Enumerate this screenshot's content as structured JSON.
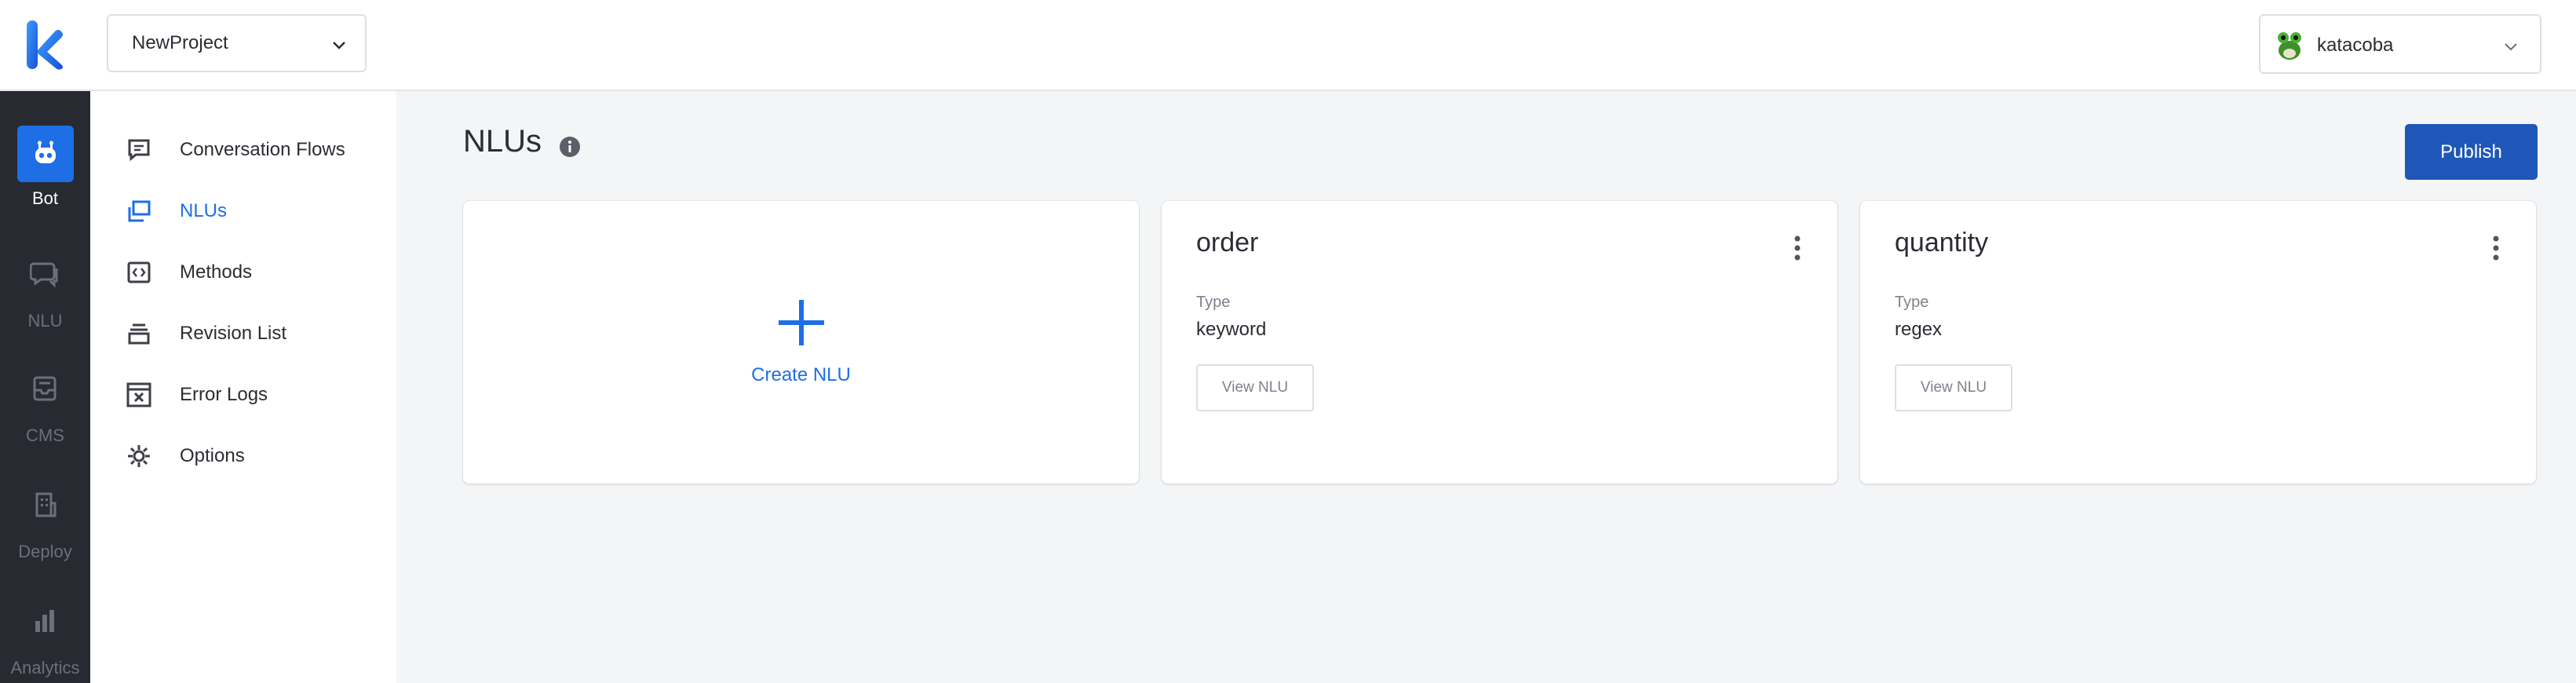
{
  "colors": {
    "accent": "#1e6ee6",
    "publish": "#1f57b8",
    "rail_bg": "#272a31"
  },
  "header": {
    "logo_icon": "katalon-k-logo",
    "project_select": {
      "value": "NewProject",
      "icon": "chevron-down-icon"
    },
    "user_menu": {
      "name": "katacoba",
      "avatar_icon": "frog-avatar",
      "icon": "chevron-down-icon"
    }
  },
  "rail": {
    "items": [
      {
        "label": "Bot",
        "icon": "robot-icon",
        "active": true
      },
      {
        "label": "NLU",
        "icon": "chat-bubbles-icon"
      },
      {
        "label": "CMS",
        "icon": "inbox-icon"
      },
      {
        "label": "Deploy",
        "icon": "building-icon"
      },
      {
        "label": "Analytics",
        "icon": "bar-chart-icon"
      }
    ]
  },
  "sidebar": {
    "items": [
      {
        "label": "Conversation Flows",
        "icon": "message-icon"
      },
      {
        "label": "NLUs",
        "icon": "stacked-windows-icon",
        "active": true
      },
      {
        "label": "Methods",
        "icon": "code-icon"
      },
      {
        "label": "Revision List",
        "icon": "layers-icon"
      },
      {
        "label": "Error Logs",
        "icon": "error-window-icon"
      },
      {
        "label": "Options",
        "icon": "gear-icon"
      }
    ]
  },
  "main": {
    "title": "NLUs",
    "info_icon": "info-icon",
    "publish_label": "Publish",
    "create_label": "Create NLU",
    "cards": [
      {
        "name": "order",
        "type_label": "Type",
        "type_value": "keyword",
        "button": "View NLU"
      },
      {
        "name": "quantity",
        "type_label": "Type",
        "type_value": "regex",
        "button": "View NLU"
      }
    ]
  }
}
